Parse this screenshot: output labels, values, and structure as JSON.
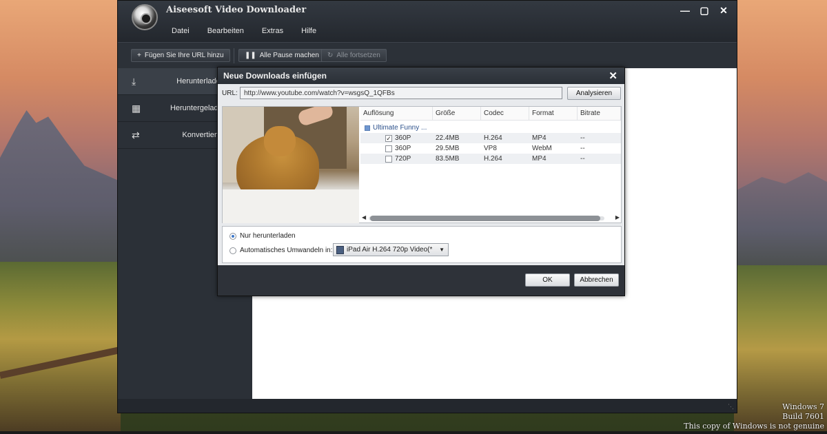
{
  "app": {
    "title": "Aiseesoft Video Downloader",
    "menu": [
      "Datei",
      "Bearbeiten",
      "Extras",
      "Hilfe"
    ],
    "window_controls": [
      "minimize-icon",
      "maximize-icon",
      "close-icon"
    ]
  },
  "toolbar": {
    "add_url": "Fügen Sie Ihre URL hinzu",
    "pause_all": "Alle Pause machen",
    "resume_all": "Alle fortsetzen"
  },
  "sidebar": {
    "items": [
      {
        "label": "Herunterladen",
        "icon": "download-icon"
      },
      {
        "label": "Heruntergeladene",
        "icon": "downloaded-icon"
      },
      {
        "label": "Konvertiert",
        "icon": "convert-icon"
      }
    ]
  },
  "dialog": {
    "title": "Neue Downloads einfügen",
    "url_label": "URL:",
    "url_value": "http://www.youtube.com/watch?v=wsgsQ_1QFBs",
    "analyze": "Analysieren",
    "columns": [
      "Auflösung",
      "Größe",
      "Codec",
      "Format",
      "Bitrate"
    ],
    "group_label": "Ultimate Funny ...",
    "rows": [
      {
        "res": "360P",
        "size": "22.4MB",
        "codec": "H.264",
        "format": "MP4",
        "bitrate": "--",
        "checked": true
      },
      {
        "res": "360P",
        "size": "29.5MB",
        "codec": "VP8",
        "format": "WebM",
        "bitrate": "--",
        "checked": false
      },
      {
        "res": "720P",
        "size": "83.5MB",
        "codec": "H.264",
        "format": "MP4",
        "bitrate": "--",
        "checked": false
      }
    ],
    "option_download_only": "Nur herunterladen",
    "option_auto_convert": "Automatisches Umwandeln in:",
    "convert_profile": "iPad Air H.264 720p Video(*",
    "ok": "OK",
    "cancel": "Abbrechen"
  },
  "watermark": {
    "line1": "Windows 7",
    "line2": "Build 7601",
    "line3": "This copy of Windows is not genuine"
  },
  "colors": {
    "window_bg": "#262b32",
    "dialog_bg": "#e8eaed",
    "accent_blue": "#3b76c9"
  }
}
